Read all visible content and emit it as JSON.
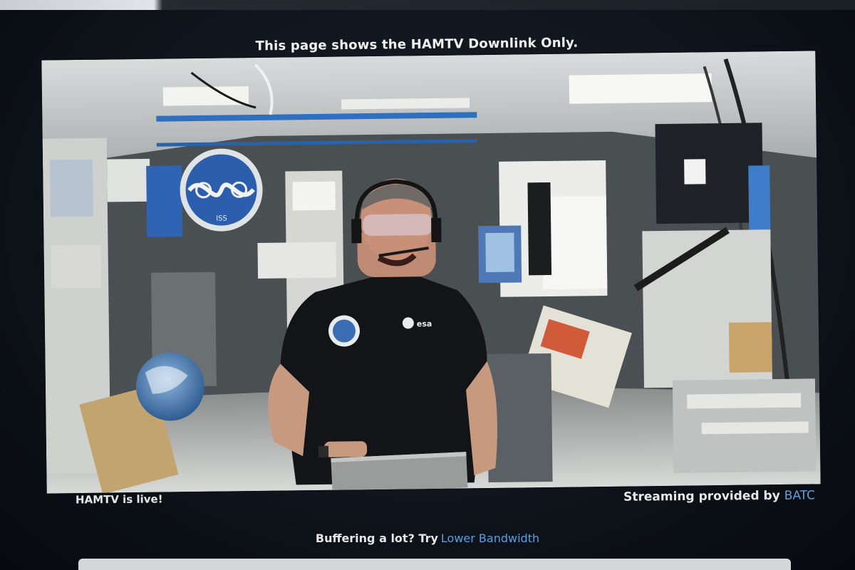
{
  "header": {
    "note": "This page shows the HAMTV Downlink Only."
  },
  "video": {
    "patch_text": "ISS",
    "crew_logo_text": "esa"
  },
  "status": {
    "live": "HAMTV is live!",
    "streaming_prefix": "Streaming provided by",
    "provider": "BATC"
  },
  "buffering": {
    "question": "Buffering a lot? Try",
    "link": "Lower Bandwidth"
  },
  "colors": {
    "link": "#5aa0de",
    "background": "#0f151c",
    "text": "#e8e8e8"
  }
}
